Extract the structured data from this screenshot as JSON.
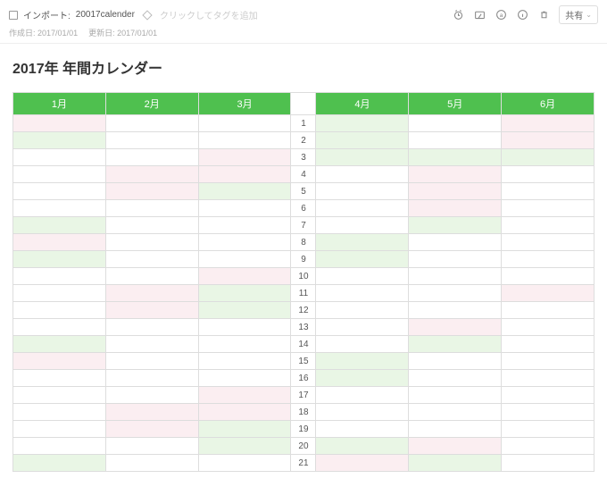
{
  "topbar": {
    "import_label": "インポート:",
    "note_name": "20017calender",
    "tag_hint": "クリックしてタグを追加",
    "share_label": "共有"
  },
  "dates": {
    "created_label": "作成日:",
    "created_value": "2017/01/01",
    "updated_label": "更新日:",
    "updated_value": "2017/01/01"
  },
  "title": "2017年 年間カレンダー",
  "months": [
    "1月",
    "2月",
    "3月",
    "4月",
    "5月",
    "6月"
  ],
  "days": [
    "1",
    "2",
    "3",
    "4",
    "5",
    "6",
    "7",
    "8",
    "9",
    "10",
    "11",
    "12",
    "13",
    "14",
    "15",
    "16",
    "17",
    "18",
    "19",
    "20",
    "21"
  ],
  "row_colors": [
    [
      "p",
      "",
      "",
      "g",
      "",
      "p"
    ],
    [
      "g",
      "",
      "",
      "g",
      "",
      "p"
    ],
    [
      "",
      "",
      "p",
      "g",
      "g",
      "g"
    ],
    [
      "",
      "p",
      "p",
      "",
      "p",
      ""
    ],
    [
      "",
      "p",
      "g",
      "",
      "p",
      ""
    ],
    [
      "",
      "",
      "",
      "",
      "p",
      ""
    ],
    [
      "g",
      "",
      "",
      "",
      "g",
      ""
    ],
    [
      "p",
      "",
      "",
      "g",
      "",
      ""
    ],
    [
      "g",
      "",
      "",
      "g",
      "",
      ""
    ],
    [
      "",
      "",
      "p",
      "",
      "",
      ""
    ],
    [
      "",
      "p",
      "g",
      "",
      "",
      "p"
    ],
    [
      "",
      "p",
      "g",
      "",
      "",
      ""
    ],
    [
      "",
      "",
      "",
      "",
      "p",
      ""
    ],
    [
      "g",
      "",
      "",
      "",
      "g",
      ""
    ],
    [
      "p",
      "",
      "",
      "g",
      "",
      ""
    ],
    [
      "",
      "",
      "",
      "g",
      "",
      ""
    ],
    [
      "",
      "",
      "p",
      "",
      "",
      ""
    ],
    [
      "",
      "p",
      "p",
      "",
      "",
      ""
    ],
    [
      "",
      "p",
      "g",
      "",
      "",
      ""
    ],
    [
      "",
      "",
      "g",
      "g",
      "p",
      ""
    ],
    [
      "g",
      "",
      "",
      "p",
      "g",
      ""
    ]
  ]
}
